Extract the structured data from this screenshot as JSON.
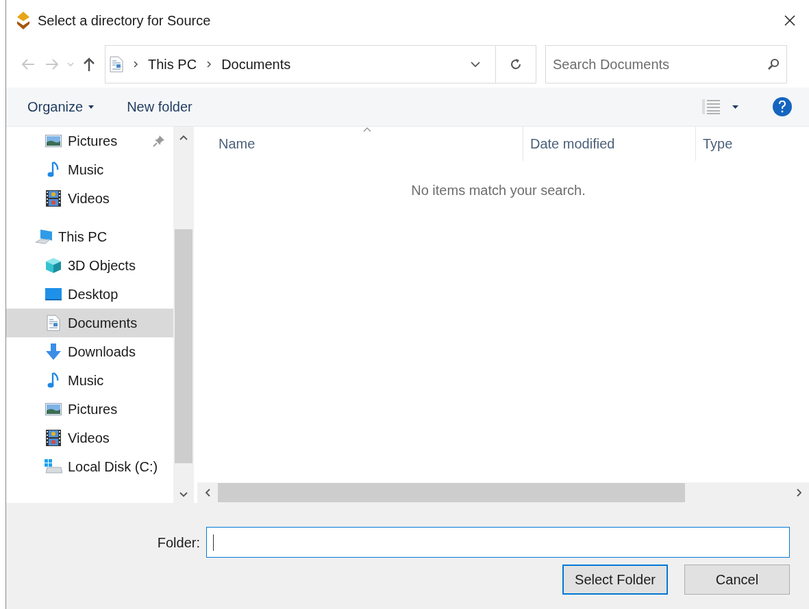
{
  "window": {
    "title": "Select a directory for Source"
  },
  "address_bar": {
    "crumbs": [
      "This PC",
      "Documents"
    ]
  },
  "search": {
    "placeholder": "Search Documents"
  },
  "toolbar": {
    "buttons": [
      "Organize",
      "New folder"
    ]
  },
  "sidebar": {
    "groups": [
      {
        "items": [
          {
            "label": "Pictures",
            "kind": "pictures",
            "pinned": true,
            "selected": false
          },
          {
            "label": "Music",
            "kind": "music",
            "pinned": false,
            "selected": false
          },
          {
            "label": "Videos",
            "kind": "videos",
            "pinned": false,
            "selected": false
          }
        ]
      },
      {
        "label": "This PC",
        "kind": "pc",
        "children": [
          {
            "label": "3D Objects",
            "kind": "cube",
            "pinned": false,
            "selected": false
          },
          {
            "label": "Desktop",
            "kind": "desktop",
            "pinned": false,
            "selected": false
          },
          {
            "label": "Documents",
            "kind": "documents",
            "pinned": false,
            "selected": true
          },
          {
            "label": "Downloads",
            "kind": "downloads",
            "pinned": false,
            "selected": false
          },
          {
            "label": "Music",
            "kind": "music",
            "pinned": false,
            "selected": false
          },
          {
            "label": "Pictures",
            "kind": "pictures",
            "pinned": false,
            "selected": false
          },
          {
            "label": "Videos",
            "kind": "videos",
            "pinned": false,
            "selected": false
          },
          {
            "label": "Local Disk (C:)",
            "kind": "disk",
            "pinned": false,
            "selected": false
          }
        ]
      }
    ]
  },
  "file_list": {
    "columns": [
      "Name",
      "Date modified",
      "Type"
    ],
    "empty_message": "No items match your search."
  },
  "footer": {
    "folder_label": "Folder:",
    "buttons": [
      {
        "label": "Select Folder",
        "kind": "default"
      },
      {
        "label": "Cancel",
        "kind": "normal"
      }
    ]
  }
}
